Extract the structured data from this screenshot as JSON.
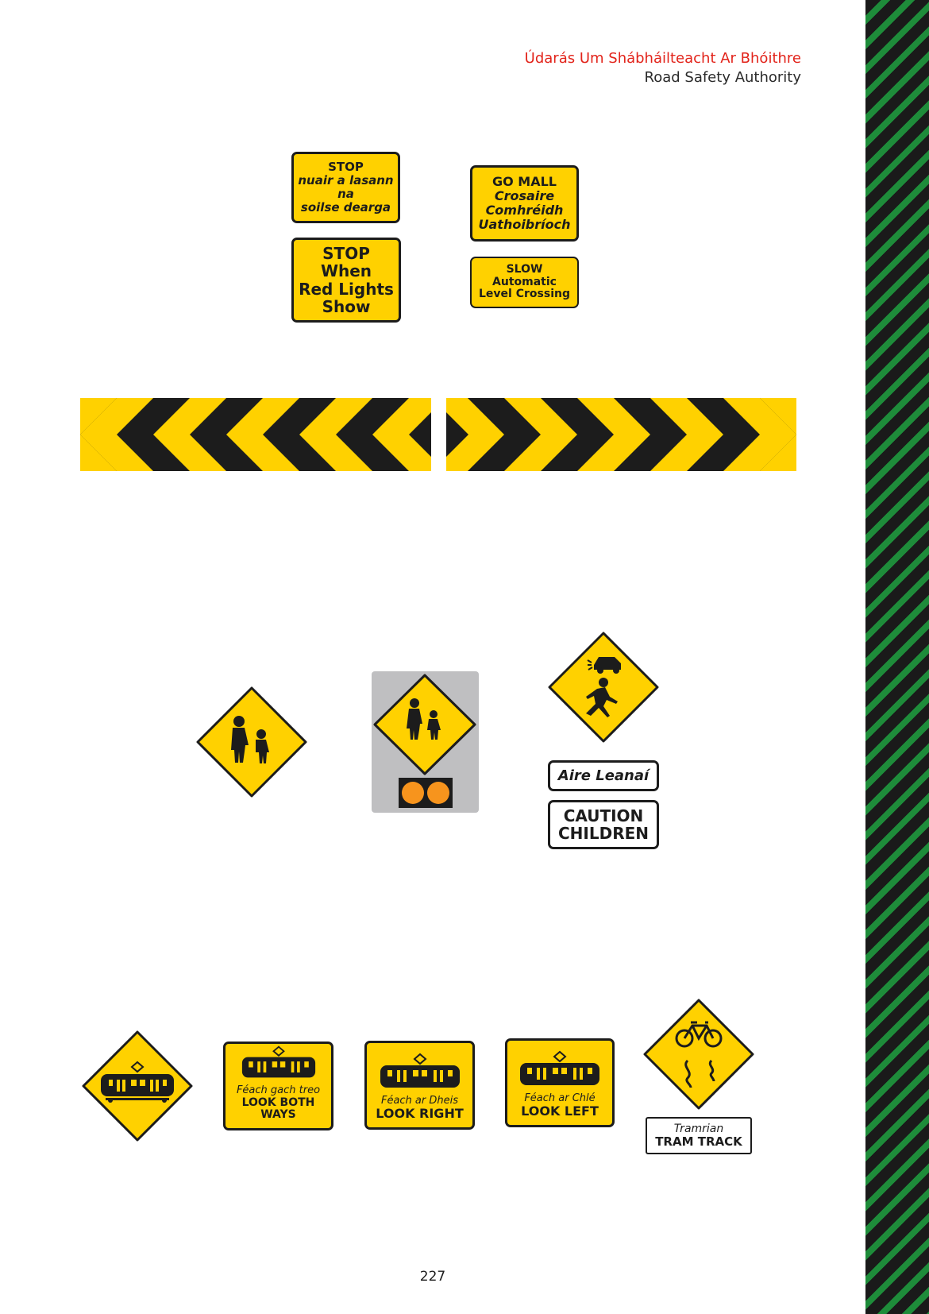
{
  "header": {
    "irish": "Údarás Um Shábháilteacht Ar Bhóithre",
    "english": "Road Safety Authority"
  },
  "signs": {
    "stop_irish": {
      "line1": "STOP",
      "line2": "nuair a lasann",
      "line3": "na",
      "line4": "soilse dearga"
    },
    "stop_english": {
      "line1": "STOP",
      "line2": "When",
      "line3": "Red Lights",
      "line4": "Show"
    },
    "gomall": {
      "line1": "GO MALL",
      "line2": "Crosaire",
      "line3": "Comhréidh",
      "line4": "Uathoibríoch"
    },
    "slow": {
      "line1": "SLOW",
      "line2": "Automatic",
      "line3": "Level Crossing"
    },
    "aire_leanai": "Aire Leanaí",
    "caution_children": {
      "line1": "CAUTION",
      "line2": "CHILDREN"
    },
    "look_both": {
      "irish": "Féach gach treo",
      "english": "LOOK BOTH WAYS"
    },
    "look_right": {
      "irish": "Féach ar Dheis",
      "english": "LOOK RIGHT"
    },
    "look_left": {
      "irish": "Féach ar Chlé",
      "english": "LOOK LEFT"
    },
    "tram_track": {
      "irish": "Tramrian",
      "english": "TRAM TRACK"
    }
  },
  "icons": [
    "chevron-left-board",
    "chevron-right-board",
    "school-children-icon",
    "school-warning-lights-icon",
    "child-car-icon",
    "tram-icon",
    "bicycle-slip-icon"
  ],
  "colors": {
    "sign_yellow": "#ffd100",
    "sign_black": "#1c1c1c",
    "header_red": "#e2231a",
    "stripe_green": "#1e8c3a",
    "lamp_orange": "#f7941d",
    "backboard_grey": "#bfbfc1"
  },
  "page_number": "227"
}
